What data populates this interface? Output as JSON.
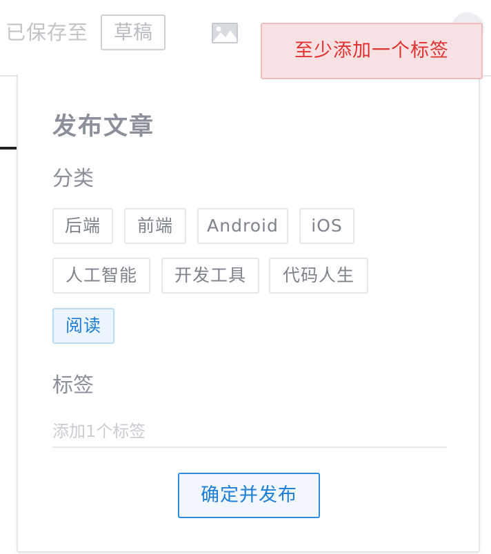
{
  "topbar": {
    "saved_text": "已保存至",
    "draft_label": "草稿",
    "image_icon": "image-icon"
  },
  "toast": {
    "message": "至少添加一个标签",
    "color": "#e03131"
  },
  "panel": {
    "title": "发布文章",
    "category_label": "分类",
    "categories": [
      {
        "label": "后端",
        "selected": false
      },
      {
        "label": "前端",
        "selected": false
      },
      {
        "label": "Android",
        "selected": false
      },
      {
        "label": "iOS",
        "selected": false
      },
      {
        "label": "人工智能",
        "selected": false
      },
      {
        "label": "开发工具",
        "selected": false
      },
      {
        "label": "代码人生",
        "selected": false
      },
      {
        "label": "阅读",
        "selected": true
      }
    ],
    "tags_label": "标签",
    "tag_input": {
      "placeholder": "添加1个标签",
      "value": ""
    },
    "publish_label": "确定并发布"
  },
  "accent_color": "#1d7dd9"
}
